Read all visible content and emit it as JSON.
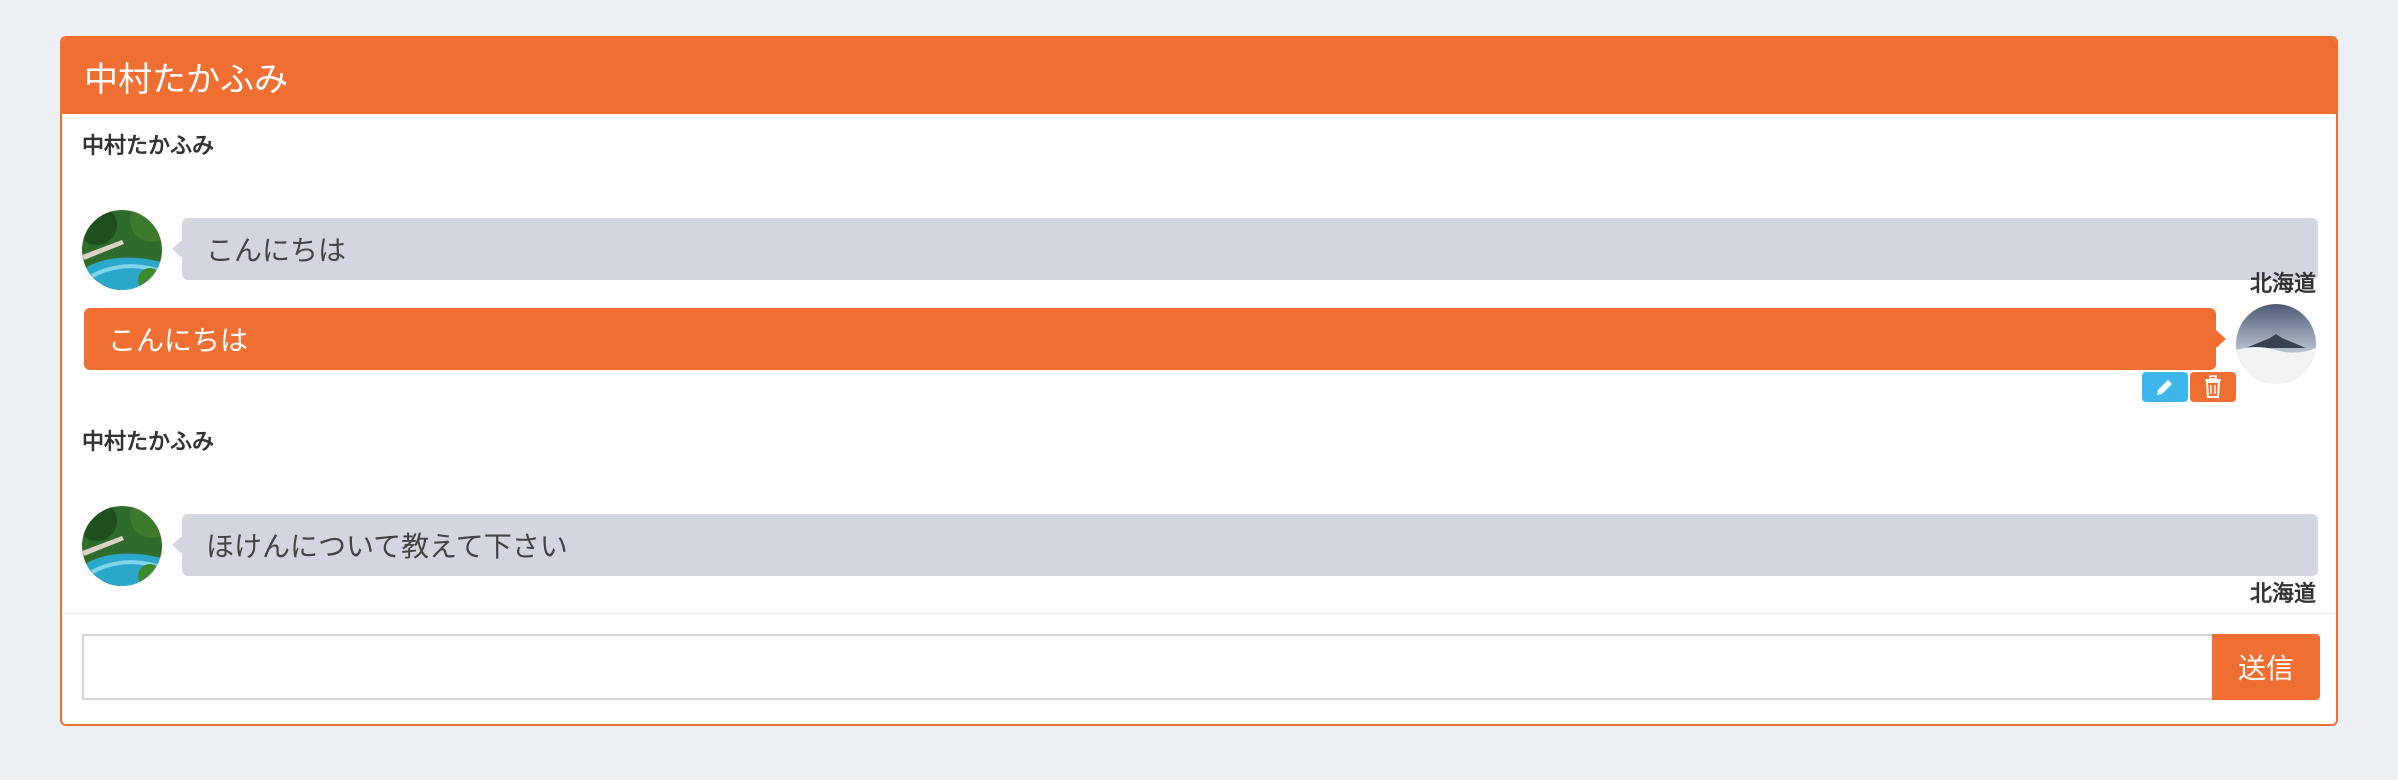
{
  "header": {
    "title": "中村たかふみ"
  },
  "messages": [
    {
      "sender": "中村たかふみ",
      "text": "こんにちは",
      "side": "left",
      "avatar": "forest-stream-avatar"
    },
    {
      "sender": "北海道",
      "text": "こんにちは",
      "side": "right",
      "avatar": "mountain-avatar",
      "actions": [
        "edit-icon",
        "trash-icon"
      ]
    },
    {
      "sender": "中村たかふみ",
      "text": "ほけんについて教えて下さい",
      "side": "left",
      "avatar": "forest-stream-avatar"
    },
    {
      "sender": "北海道",
      "text": "",
      "side": "right",
      "avatar": "mountain-avatar"
    }
  ],
  "footer": {
    "input_value": "",
    "input_placeholder": "",
    "send_label": "送信"
  },
  "colors": {
    "accent": "#ef6f32",
    "edit": "#3fb6ea",
    "bubble_left": "#d3d6de",
    "background": "#ecf0f4"
  }
}
